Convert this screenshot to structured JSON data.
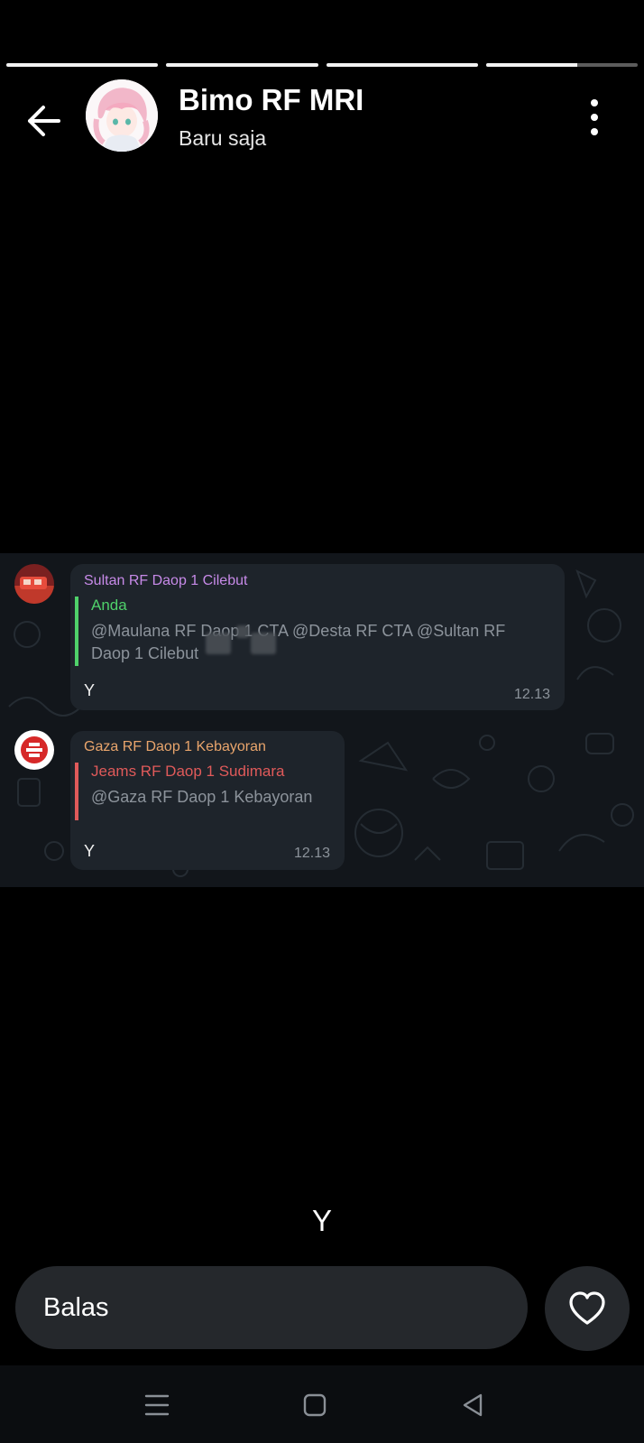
{
  "story": {
    "progress": [
      1,
      1,
      1,
      0.6
    ],
    "poster_name": "Bimo RF MRI",
    "poster_time": "Baru saja",
    "caption": "Y"
  },
  "chat": {
    "messages": [
      {
        "sender": "Sultan RF Daop 1 Cilebut",
        "sender_color": "#c78ae8",
        "quote_title": "Anda",
        "quote_color": "#4fd16a",
        "quote_text": "@Maulana RF Daop 1 CTA @Desta RF CTA @Sultan RF Daop 1 Cilebut",
        "text": "Y",
        "time": "12.13"
      },
      {
        "sender": "Gaza RF Daop 1 Kebayoran",
        "sender_color": "#e9a56c",
        "quote_title": "Jeams RF Daop 1 Sudimara",
        "quote_color": "#e05a5a",
        "quote_text": "@Gaza RF Daop 1 Kebayoran",
        "text": "Y",
        "time": "12.13"
      }
    ]
  },
  "reply": {
    "placeholder": "Balas"
  },
  "icons": {
    "back": "arrow-left-icon",
    "more": "more-vertical-icon",
    "like": "heart-icon",
    "nav_recents": "menu-icon",
    "nav_home": "square-icon",
    "nav_back": "triangle-back-icon"
  }
}
